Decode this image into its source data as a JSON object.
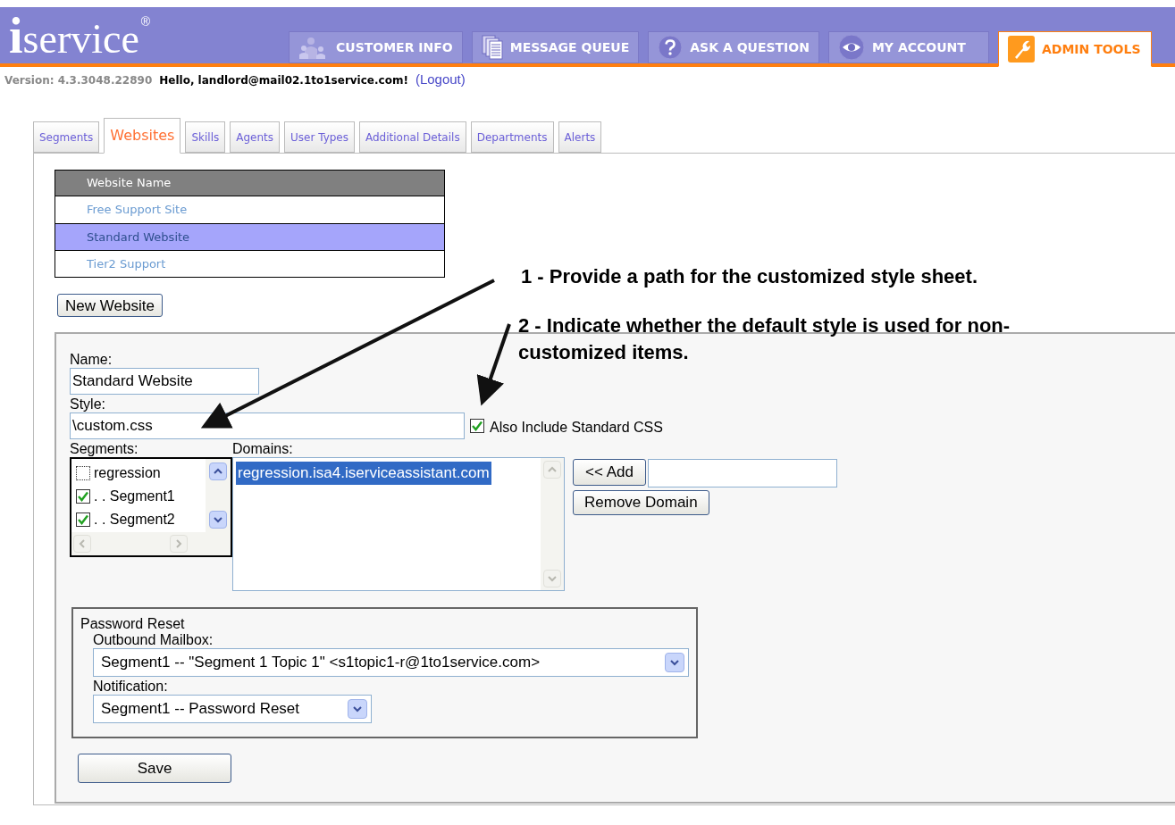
{
  "header": {
    "logo": "iservice",
    "logo_mark": "®",
    "nav_tabs": [
      {
        "label": "CUSTOMER INFO",
        "selected": false
      },
      {
        "label": "MESSAGE QUEUE",
        "selected": false
      },
      {
        "label": "ASK A QUESTION",
        "selected": false
      },
      {
        "label": "MY ACCOUNT",
        "selected": false
      },
      {
        "label": "ADMIN TOOLS",
        "selected": true
      }
    ]
  },
  "user_bar": {
    "version": "Version: 4.3.3048.22890",
    "greeting": "Hello, landlord@mail02.1to1service.com!",
    "logout": "(Logout)"
  },
  "admin_tabs": [
    {
      "label": "Segments",
      "selected": false
    },
    {
      "label": "Websites",
      "selected": true
    },
    {
      "label": "Skills",
      "selected": false
    },
    {
      "label": "Agents",
      "selected": false
    },
    {
      "label": "User Types",
      "selected": false
    },
    {
      "label": "Additional Details",
      "selected": false
    },
    {
      "label": "Departments",
      "selected": false
    },
    {
      "label": "Alerts",
      "selected": false
    }
  ],
  "websites_table": {
    "column": "Website Name",
    "rows": [
      {
        "name": "Free Support Site",
        "selected": false
      },
      {
        "name": "Standard Website",
        "selected": true
      },
      {
        "name": "Tier2 Support",
        "selected": false
      }
    ]
  },
  "new_website_button": "New Website",
  "form": {
    "name_label": "Name:",
    "name_value": "Standard Website",
    "style_label": "Style:",
    "style_value": "\\custom.css",
    "include_standard_css": {
      "label": "Also Include Standard CSS",
      "checked": true
    },
    "segments_label": "Segments:",
    "segments": [
      {
        "label": "regression",
        "checked": false
      },
      {
        "label": ". . Segment1",
        "checked": true
      },
      {
        "label": ". . Segment2",
        "checked": true
      }
    ],
    "domains_label": "Domains:",
    "domains": [
      {
        "text": "regression.isa4.iserviceassistant.com",
        "selected": true
      }
    ],
    "add_button": "<< Add",
    "remove_domain_button": "Remove Domain",
    "password_reset": {
      "legend": "Password Reset",
      "outbound_label": "Outbound Mailbox:",
      "outbound_value": "Segment1 -- \"Segment 1 Topic 1\" <s1topic1-r@1to1service.com>",
      "notification_label": "Notification:",
      "notification_value": "Segment1 -- Password Reset"
    },
    "save_button": "Save"
  },
  "annotations": [
    "1 - Provide a path for the customized style sheet.",
    "2 - Indicate whether the default style is used for non-customized items."
  ]
}
